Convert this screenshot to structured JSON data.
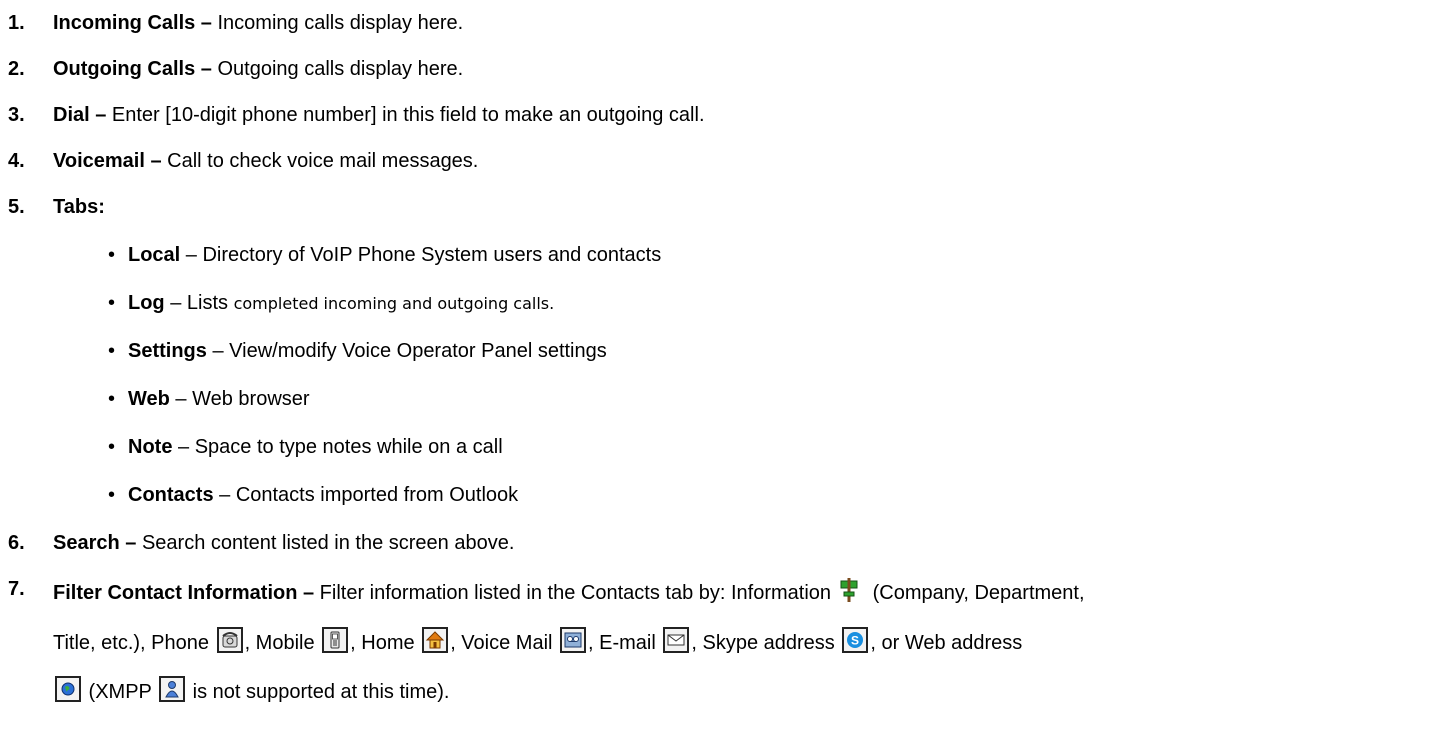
{
  "items": [
    {
      "num": "1.",
      "term": "Incoming Calls –",
      "desc": " Incoming calls display here."
    },
    {
      "num": "2.",
      "term": "Outgoing Calls –",
      "desc": " Outgoing calls display here."
    },
    {
      "num": "3.",
      "term": "Dial –",
      "desc": " Enter [10-digit phone number] in this field to make an outgoing call."
    },
    {
      "num": "4.",
      "term": "Voicemail –",
      "desc": " Call to check voice mail messages."
    },
    {
      "num": "5.",
      "term": "Tabs:",
      "desc": ""
    },
    {
      "num": "6.",
      "term": "Search –",
      "desc": " Search content listed in the screen above."
    },
    {
      "num": "7.",
      "term": "Filter Contact Information –",
      "desc": " Filter information listed in the Contacts tab by: Information"
    }
  ],
  "tabs": [
    {
      "term": "Local",
      "desc": " – Directory of VoIP Phone System users and contacts"
    },
    {
      "term": "Log",
      "desc": " – Lists ",
      "desc_small": "completed incoming and outgoing calls."
    },
    {
      "term": "Settings",
      "desc": " – View/modify Voice Operator Panel settings"
    },
    {
      "term": "Web",
      "desc": " – Web browser"
    },
    {
      "term": "Note",
      "desc": " – Space to type notes while on a call"
    },
    {
      "term": "Contacts",
      "desc": " – Contacts imported from Outlook"
    }
  ],
  "filter": {
    "line1_tail": " (Company, Department,",
    "title_part": "Title, etc.), Phone",
    "mobile": ", Mobile",
    "home": ", Home",
    "voicemail": ", Voice Mail",
    "email": ", E-mail",
    "skype": ", Skype address",
    "web": ", or Web address",
    "xmpp": " (XMPP",
    "tail": " is not supported at this time)."
  },
  "icons": [
    "information-icon",
    "phone-icon",
    "mobile-icon",
    "home-icon",
    "voicemail-icon",
    "email-icon",
    "skype-icon",
    "web-icon",
    "xmpp-icon"
  ],
  "colors": {
    "home_orange": "#e07a10",
    "skype_blue": "#1a8fe0",
    "info_green": "#2ea12e",
    "globe_blue": "#2a6fd6"
  }
}
